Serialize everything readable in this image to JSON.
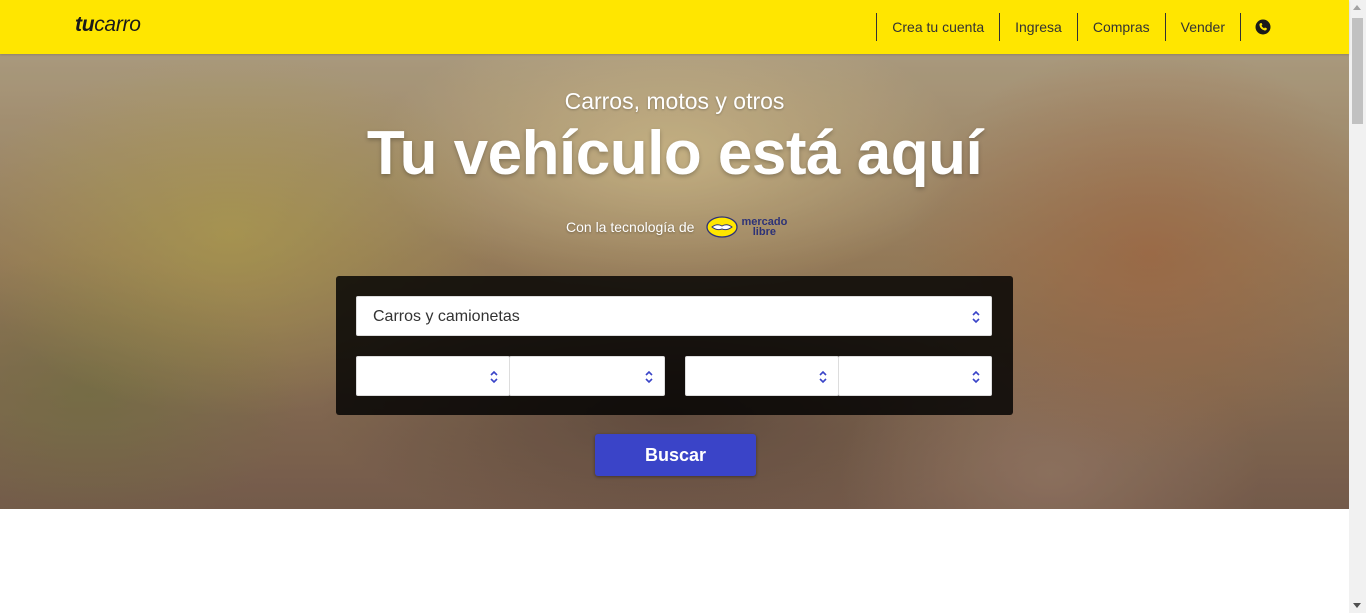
{
  "header": {
    "logo_bold": "tu",
    "logo_light": "carro",
    "nav": [
      "Crea tu cuenta",
      "Ingresa",
      "Compras",
      "Vender"
    ],
    "phone_icon": "phone-icon"
  },
  "hero": {
    "subtitle": "Carros, motos y otros",
    "title": "Tu vehículo está aquí",
    "tech_text": "Con la tecnología de",
    "ml_line1": "mercado",
    "ml_line2": "libre"
  },
  "search": {
    "vehicle_type": "Carros y camionetas",
    "filter1": "",
    "filter2": "",
    "filter3": "",
    "filter4": "",
    "button_label": "Buscar"
  },
  "colors": {
    "header_bg": "#ffe600",
    "button_bg": "#3a44c8",
    "panel_bg": "#000000"
  }
}
